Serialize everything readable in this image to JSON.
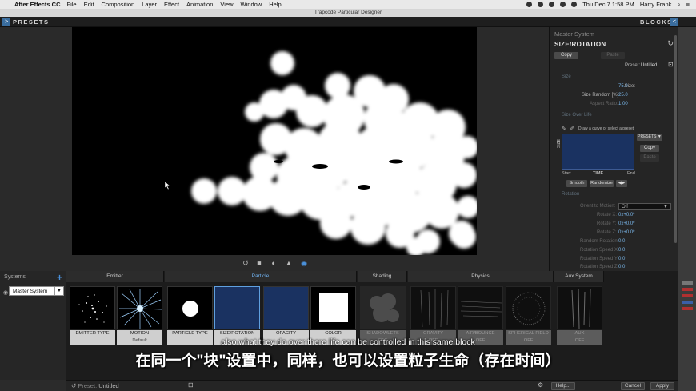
{
  "menubar": {
    "app": "After Effects CC",
    "items": [
      "File",
      "Edit",
      "Composition",
      "Layer",
      "Effect",
      "Animation",
      "View",
      "Window",
      "Help"
    ],
    "clock": "Thu Dec 7  1:58 PM",
    "user": "Harry Frank"
  },
  "window": {
    "title": "Trapcode Particular Designer"
  },
  "topbar": {
    "left_label": "PRESETS",
    "right_label": "BLOCKS"
  },
  "panel": {
    "system": "Master System",
    "block_title": "SIZE/ROTATION",
    "copy": "Copy",
    "paste": "Paste",
    "preset_label": "Preset:",
    "preset_value": "Untitled",
    "size_section": "Size",
    "size_label": "Size:",
    "size_value": "75.0",
    "size_random_label": "Size Random [%]:",
    "size_random_value": "25.0",
    "aspect_label": "Aspect Ratio:",
    "aspect_value": "1.00",
    "sol_section": "Size Over Life",
    "draw_hint": "Draw a curve or select a preset",
    "presets_btn": "PRESETS ▼",
    "curve_copy": "Copy",
    "curve_paste": "Paste",
    "axis_size": "SIZE",
    "start": "Start",
    "time": "TIME",
    "end": "End",
    "smooth": "Smooth",
    "randomize": "Randomize",
    "flip": "◀▶",
    "rotation_section": "Rotation",
    "orient_label": "Orient to Motion:",
    "orient_value": "Off",
    "rot_x_label": "Rotate X:",
    "rot_x_value": "0x+0.0º",
    "rot_y_label": "Rotate Y:",
    "rot_y_value": "0x+0.0º",
    "rot_z_label": "Rotate Z:",
    "rot_z_value": "0x+0.0º",
    "rand_rot_label": "Random Rotation:",
    "rand_rot_value": "0.0",
    "rsx_label": "Rotation Speed X:",
    "rsx_value": "0.0",
    "rsy_label": "Rotation Speed Y:",
    "rsy_value": "0.0",
    "rsz_label": "Rotation Speed Z:",
    "rsz_value": "0.0"
  },
  "systems": {
    "header": "Systems",
    "selected": "Master System"
  },
  "groups": [
    "Emitter",
    "Particle",
    "Shading",
    "Physics",
    "Aux System"
  ],
  "tiles": [
    {
      "name": "EMITTER TYPE",
      "sub": ""
    },
    {
      "name": "MOTION",
      "sub": "Default"
    },
    {
      "name": "PARTICLE TYPE",
      "sub": ""
    },
    {
      "name": "SIZE/ROTATION",
      "sub": ""
    },
    {
      "name": "OPACITY",
      "sub": ""
    },
    {
      "name": "COLOR",
      "sub": ""
    },
    {
      "name": "SHADOWLETS",
      "sub": "OFF"
    },
    {
      "name": "GRAVITY",
      "sub": "OFF"
    },
    {
      "name": "AIR/BOUNCE",
      "sub": "OFF"
    },
    {
      "name": "SPHERICAL FIELD",
      "sub": "OFF"
    },
    {
      "name": "AUX",
      "sub": "OFF"
    }
  ],
  "subtitles": {
    "en": "also what  they do over there life can be controlled in this same block",
    "zh": "在同一个\"块\"设置中，同样，也可以设置粒子生命（存在时间）"
  },
  "bottom": {
    "preset_label": "Preset:",
    "preset_value": "Untitled",
    "help": "Help...",
    "cancel": "Cancel",
    "apply": "Apply"
  },
  "colors": {
    "accent": "#4a90d9",
    "curve_bg": "#1a3261",
    "value_text": "#79b6ea"
  },
  "icons": [
    "apple-icon",
    "reset-icon",
    "save-preset-icon",
    "eyedropper-icon",
    "eye-icon",
    "camera-icon",
    "undo-icon",
    "gear-icon"
  ]
}
